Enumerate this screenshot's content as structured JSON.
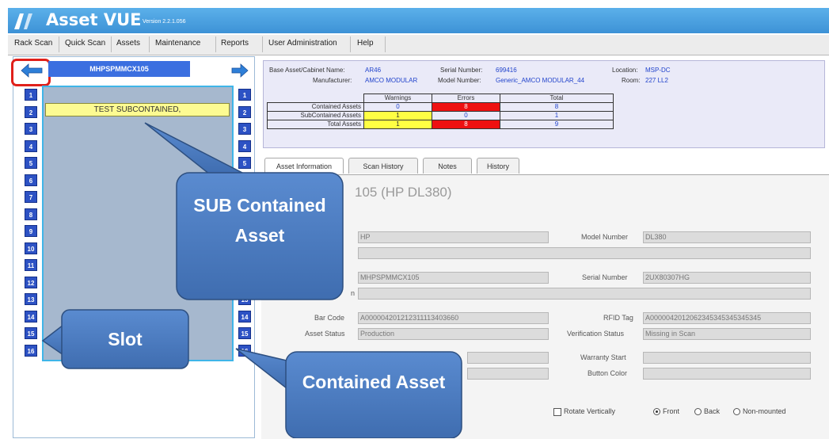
{
  "app": {
    "title": "Asset VUE",
    "version": "Version 2.2.1.056"
  },
  "menu": [
    "Rack Scan",
    "Quick Scan",
    "Assets",
    "Maintenance",
    "Reports",
    "User Administration",
    "Help"
  ],
  "rack": {
    "name": "MHPSPMMCX105",
    "slots_left": [
      "1",
      "2",
      "3",
      "4",
      "5",
      "6",
      "7",
      "8",
      "9",
      "10",
      "11",
      "12",
      "13",
      "14",
      "15",
      "16"
    ],
    "slots_right": [
      "1",
      "2",
      "3",
      "4",
      "5",
      "6",
      "7",
      "8",
      "9",
      "10",
      "11",
      "12",
      "13",
      "14",
      "15",
      "16"
    ],
    "subcontained_label": "TEST SUBCONTAINED,"
  },
  "info": {
    "base_asset_label": "Base Asset/Cabinet Name:",
    "base_asset_value": "AR46",
    "serial_label": "Serial Number:",
    "serial_value": "699416",
    "location_label": "Location:",
    "location_value": "MSP-DC",
    "manufacturer_label": "Manufacturer:",
    "manufacturer_value": "AMCO MODULAR",
    "model_label": "Model Number:",
    "model_value": "Generic_AMCO MODULAR_44",
    "room_label": "Room:",
    "room_value": "227 LL2"
  },
  "summary": {
    "headers": [
      "Warnings",
      "Errors",
      "Total"
    ],
    "rows": [
      {
        "label": "Contained Assets",
        "warnings": "0",
        "errors": "8",
        "total": "8"
      },
      {
        "label": "SubContained Assets",
        "warnings": "1",
        "errors": "0",
        "total": "1"
      },
      {
        "label": "Total Assets",
        "warnings": "1",
        "errors": "8",
        "total": "9"
      }
    ]
  },
  "tabs": [
    "Asset Information",
    "Scan History",
    "Notes",
    "History"
  ],
  "asset": {
    "heading_visible": "105 (HP DL380)",
    "manufacturer_value": "HP",
    "model_label": "Model Number",
    "model_value": "DL380",
    "name_value": "MHPSPMMCX105",
    "serial_label": "Serial Number",
    "serial_value": "2UX80307HG",
    "description_suffix": "n",
    "barcode_label": "Bar Code",
    "barcode_value": "A000004201212311113403660",
    "rfid_label": "RFID Tag",
    "rfid_value": "A0000042012062345345345345345",
    "status_label": "Asset Status",
    "status_value": "Production",
    "verification_label": "Verification Status",
    "verification_value": "Missing in Scan",
    "warranty_label": "Warranty Start",
    "warranty_value": "",
    "button_color_label": "Button Color",
    "button_color_value": ""
  },
  "options": {
    "rotate_label": "Rotate Vertically",
    "radios": [
      {
        "label": "Front",
        "selected": true
      },
      {
        "label": "Back",
        "selected": false
      },
      {
        "label": "Non-mounted",
        "selected": false
      }
    ]
  },
  "callouts": {
    "sub": "SUB Contained Asset",
    "slot": "Slot",
    "contained": "Contained Asset"
  },
  "colors": {
    "title_bar": "#4aa3e2",
    "slot_blue": "#2d52c4",
    "callout_blue": "#4c7dc2",
    "highlight_red": "#e0201a",
    "warning_yellow": "#ffff44",
    "error_red": "#ee1111"
  }
}
